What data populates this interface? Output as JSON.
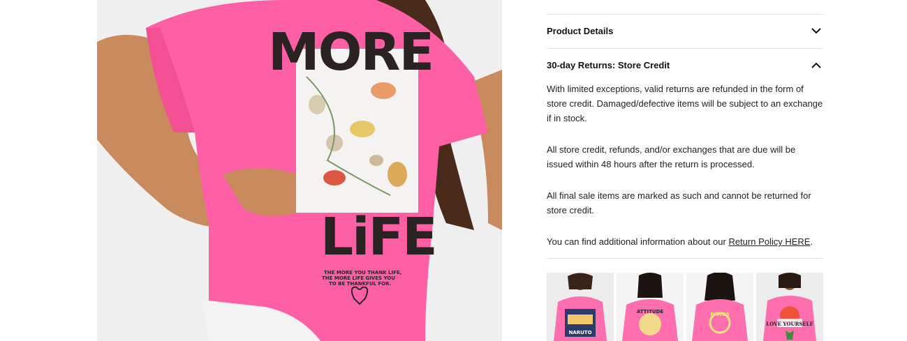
{
  "product_image": {
    "print_word_top": "MORE",
    "print_word_bottom": "LiFE",
    "print_caption_line1": "THE MORE YOU THANK LIFE,",
    "print_caption_line2": "THE MORE LIFE GIVES YOU",
    "print_caption_line3": "TO BE THANKFUL FOR."
  },
  "accordion": {
    "product_details_label": "Product Details",
    "returns_label": "30-day Returns: Store Credit"
  },
  "returns": {
    "paragraph1": "With limited exceptions, valid returns are refunded in the form of store credit. Damaged/defective items will be subject to an exchange if in stock.",
    "paragraph2": "All store credit, refunds, and/or exchanges that are due will be issued within 48 hours after the return is processed.",
    "paragraph3": "All final sale items are marked as such and cannot be returned for store credit.",
    "paragraph4_prefix": "You can find additional information about our ",
    "paragraph4_link": "Return Policy HERE",
    "paragraph4_suffix": "."
  },
  "thumbnails": [
    {
      "print_text": "NARUTO"
    },
    {
      "print_text": "ATTITUDE"
    },
    {
      "print_text": "PISCES"
    },
    {
      "print_text": "LOVE YOURSELF"
    }
  ],
  "colors": {
    "shirt_pink": "#ff5fa5",
    "background": "#ffffff",
    "divider": "#e5e5e5"
  }
}
